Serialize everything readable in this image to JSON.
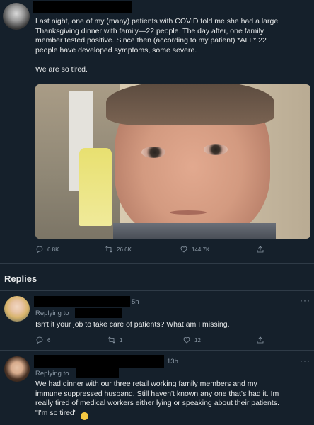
{
  "tweet": {
    "text_lines": [
      "Last night, one of my (many) patients with COVID told me she had a large",
      "Thanksgiving dinner with family—22 people. The day after, one family",
      "member tested positive. Since then (according to my patient) *ALL* 22",
      "people have developed symptoms, some severe."
    ],
    "text_last": "We are so tired.",
    "actions": {
      "replies": "6.8K",
      "retweets": "26.6K",
      "likes": "144.7K"
    }
  },
  "replies_header": "Replies",
  "reply1": {
    "time": "5h",
    "replying_to": "Replying to",
    "text": "Isn't it your job to take care of patients? What am I missing.",
    "actions": {
      "replies": "6",
      "retweets": "1",
      "likes": "12"
    }
  },
  "reply2": {
    "time": "13h",
    "replying_to": "Replying to",
    "text_lines": [
      "We had dinner with our three retail working family members and my",
      "immune suppressed husband.  Still haven't known any one that's had it. Im",
      "really tired of medical workers either lying or speaking about their patients.",
      "\"I'm so tired\""
    ],
    "emoji": "😊"
  },
  "colors": {
    "background": "#15202b",
    "text": "#e7e9ea",
    "muted": "#8b98a5",
    "divider": "#2f3b47"
  }
}
